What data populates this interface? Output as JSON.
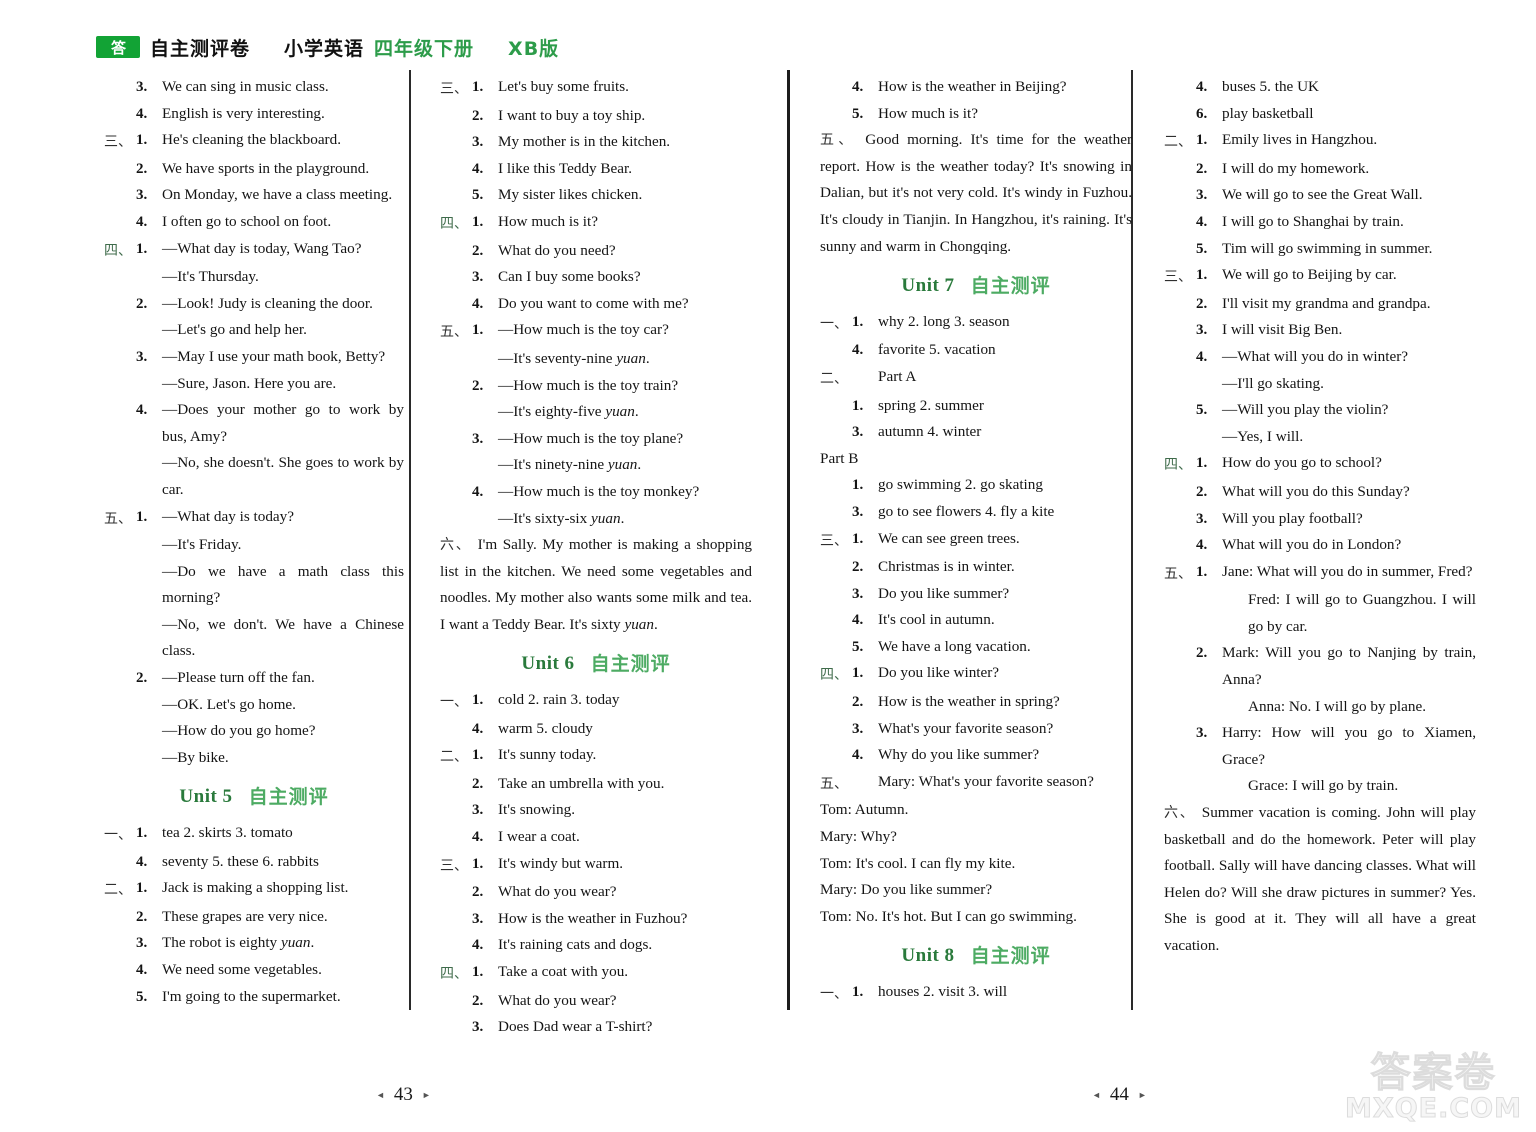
{
  "masthead": {
    "logo_text": "答",
    "title_cn": "自主测评卷",
    "subject": "小学英语",
    "grade": "四年级下册",
    "edition": "XB版",
    "brand_color": "#12a335"
  },
  "columns": {
    "col1": [
      {
        "kind": "item",
        "sec": "",
        "num": "3.",
        "text": "We can sing in music class."
      },
      {
        "kind": "item",
        "sec": "",
        "num": "4.",
        "text": "English is very interesting."
      },
      {
        "kind": "item",
        "sec": "三、",
        "num": "1.",
        "text": "He's cleaning the blackboard."
      },
      {
        "kind": "item",
        "sec": "",
        "num": "2.",
        "text": "We have sports in the playground."
      },
      {
        "kind": "item",
        "sec": "",
        "num": "3.",
        "text": "On Monday, we have a class meeting.",
        "justify": true
      },
      {
        "kind": "item",
        "sec": "",
        "num": "4.",
        "text": "I often go to school on foot."
      },
      {
        "kind": "item",
        "sec": "四、",
        "num": "1.",
        "text": "—What day is today, Wang Tao?",
        "box": true
      },
      {
        "kind": "hang",
        "text": "—It's Thursday."
      },
      {
        "kind": "item",
        "sec": "",
        "num": "2.",
        "text": "—Look! Judy is cleaning the door."
      },
      {
        "kind": "hang",
        "text": "—Let's go and help her."
      },
      {
        "kind": "item",
        "sec": "",
        "num": "3.",
        "text": "—May I use your math book, Betty?",
        "justify": true
      },
      {
        "kind": "hang",
        "text": "—Sure, Jason. Here you are."
      },
      {
        "kind": "item",
        "sec": "",
        "num": "4.",
        "text": "—Does your mother go to work by bus, Amy?",
        "justify": true
      },
      {
        "kind": "hang",
        "text": "—No, she doesn't. She goes to work by car.",
        "justify": true
      },
      {
        "kind": "item",
        "sec": "五、",
        "num": "1.",
        "text": "—What day is today?"
      },
      {
        "kind": "hang",
        "text": "—It's Friday."
      },
      {
        "kind": "hang",
        "text": "—Do we have a math class this morning?",
        "justify": true
      },
      {
        "kind": "hang",
        "text": "—No, we don't. We have a Chinese class.",
        "justify": true
      },
      {
        "kind": "item",
        "sec": "",
        "num": "2.",
        "text": "—Please turn off the fan."
      },
      {
        "kind": "hang",
        "text": "—OK. Let's go home."
      },
      {
        "kind": "hang",
        "text": "—How do you go home?"
      },
      {
        "kind": "hang",
        "text": "—By bike."
      },
      {
        "kind": "unit",
        "en": "Unit 5",
        "cn": "自主测评"
      },
      {
        "kind": "item",
        "sec": "一、",
        "num": "1.",
        "text": "tea   2. skirts   3. tomato"
      },
      {
        "kind": "item",
        "sec": "",
        "num": "4.",
        "text": "seventy   5. these   6. rabbits"
      },
      {
        "kind": "item",
        "sec": "二、",
        "num": "1.",
        "text": "Jack is making a shopping list."
      },
      {
        "kind": "item",
        "sec": "",
        "num": "2.",
        "text": "These grapes are very nice."
      },
      {
        "kind": "item",
        "sec": "",
        "num": "3.",
        "text": "The robot is eighty ",
        "italic": "yuan",
        "tail": "."
      },
      {
        "kind": "item",
        "sec": "",
        "num": "4.",
        "text": "We need some vegetables."
      },
      {
        "kind": "item",
        "sec": "",
        "num": "5.",
        "text": "I'm going to the supermarket."
      }
    ],
    "col2": [
      {
        "kind": "item",
        "sec": "三、",
        "num": "1.",
        "text": "Let's buy some fruits."
      },
      {
        "kind": "item",
        "sec": "",
        "num": "2.",
        "text": "I want to buy a toy ship."
      },
      {
        "kind": "item",
        "sec": "",
        "num": "3.",
        "text": "My mother is in the kitchen."
      },
      {
        "kind": "item",
        "sec": "",
        "num": "4.",
        "text": "I like this Teddy Bear."
      },
      {
        "kind": "item",
        "sec": "",
        "num": "5.",
        "text": "My sister likes chicken."
      },
      {
        "kind": "item",
        "sec": "四、",
        "num": "1.",
        "text": "How much is it?",
        "box": true
      },
      {
        "kind": "item",
        "sec": "",
        "num": "2.",
        "text": "What do you need?"
      },
      {
        "kind": "item",
        "sec": "",
        "num": "3.",
        "text": "Can I buy some books?"
      },
      {
        "kind": "item",
        "sec": "",
        "num": "4.",
        "text": "Do you want to come with me?"
      },
      {
        "kind": "item",
        "sec": "五、",
        "num": "1.",
        "text": "—How much is the toy car?"
      },
      {
        "kind": "hang",
        "text": "—It's seventy-nine ",
        "italic": "yuan",
        "tail": "."
      },
      {
        "kind": "item",
        "sec": "",
        "num": "2.",
        "text": "—How much is the toy train?"
      },
      {
        "kind": "hang",
        "text": "—It's eighty-five ",
        "italic": "yuan",
        "tail": "."
      },
      {
        "kind": "item",
        "sec": "",
        "num": "3.",
        "text": "—How much is the toy plane?"
      },
      {
        "kind": "hang",
        "text": "—It's ninety-nine ",
        "italic": "yuan",
        "tail": "."
      },
      {
        "kind": "item",
        "sec": "",
        "num": "4.",
        "text": "—How much is the toy monkey?"
      },
      {
        "kind": "hang",
        "text": "—It's sixty-six ",
        "italic": "yuan",
        "tail": "."
      },
      {
        "kind": "para",
        "lead": "六、",
        "text": "I'm Sally. My mother is making a shopping list in the kitchen. We need some vegetables and noodles. My mother also wants some milk and tea. I want a Teddy Bear. It's sixty ",
        "italic": "yuan",
        "tail": "."
      },
      {
        "kind": "unit",
        "en": "Unit 6",
        "cn": "自主测评"
      },
      {
        "kind": "item",
        "sec": "一、",
        "num": "1.",
        "text": "cold   2. rain   3. today"
      },
      {
        "kind": "item",
        "sec": "",
        "num": "4.",
        "text": "warm   5. cloudy"
      },
      {
        "kind": "item",
        "sec": "二、",
        "num": "1.",
        "text": "It's sunny today."
      },
      {
        "kind": "item",
        "sec": "",
        "num": "2.",
        "text": "Take an umbrella with you."
      },
      {
        "kind": "item",
        "sec": "",
        "num": "3.",
        "text": "It's snowing."
      },
      {
        "kind": "item",
        "sec": "",
        "num": "4.",
        "text": "I wear a coat."
      },
      {
        "kind": "item",
        "sec": "三、",
        "num": "1.",
        "text": "It's windy but warm."
      },
      {
        "kind": "item",
        "sec": "",
        "num": "2.",
        "text": "What do you wear?"
      },
      {
        "kind": "item",
        "sec": "",
        "num": "3.",
        "text": "How is the weather in Fuzhou?",
        "justify": true
      },
      {
        "kind": "item",
        "sec": "",
        "num": "4.",
        "text": "It's raining cats and dogs."
      },
      {
        "kind": "item",
        "sec": "四、",
        "num": "1.",
        "text": "Take a coat with you.",
        "box": true
      },
      {
        "kind": "item",
        "sec": "",
        "num": "2.",
        "text": "What do you wear?"
      },
      {
        "kind": "item",
        "sec": "",
        "num": "3.",
        "text": "Does Dad wear a T-shirt?"
      }
    ],
    "col3": [
      {
        "kind": "item",
        "sec": "",
        "num": "4.",
        "text": "How is the weather in Beijing?",
        "justify": true
      },
      {
        "kind": "item",
        "sec": "",
        "num": "5.",
        "text": "How much is it?"
      },
      {
        "kind": "para",
        "lead": "五、",
        "text": "Good morning. It's time for the weather report. How is the weather today? It's snowing in Dalian, but it's not very cold. It's windy in Fuzhou. It's cloudy in Tianjin. In Hangzhou, it's raining. It's sunny and warm in Chongqing."
      },
      {
        "kind": "unit",
        "en": "Unit 7",
        "cn": "自主测评"
      },
      {
        "kind": "item",
        "sec": "一、",
        "num": "1.",
        "text": "why   2. long   3. season"
      },
      {
        "kind": "item",
        "sec": "",
        "num": "4.",
        "text": "favorite   5. vacation"
      },
      {
        "kind": "item",
        "sec": "二、",
        "num": "",
        "text": "Part A"
      },
      {
        "kind": "item",
        "sec": "",
        "num": "1.",
        "text": "spring   2. summer"
      },
      {
        "kind": "item",
        "sec": "",
        "num": "3.",
        "text": "autumn   4. winter"
      },
      {
        "kind": "plain",
        "text": "Part B"
      },
      {
        "kind": "item",
        "sec": "",
        "num": "1.",
        "text": "go swimming   2. go skating"
      },
      {
        "kind": "item",
        "sec": "",
        "num": "3.",
        "text": "go to see flowers   4. fly a kite"
      },
      {
        "kind": "item",
        "sec": "三、",
        "num": "1.",
        "text": "We can see green trees."
      },
      {
        "kind": "item",
        "sec": "",
        "num": "2.",
        "text": "Christmas is in winter."
      },
      {
        "kind": "item",
        "sec": "",
        "num": "3.",
        "text": "Do you like summer?"
      },
      {
        "kind": "item",
        "sec": "",
        "num": "4.",
        "text": "It's cool in autumn."
      },
      {
        "kind": "item",
        "sec": "",
        "num": "5.",
        "text": "We have a long vacation."
      },
      {
        "kind": "item",
        "sec": "四、",
        "num": "1.",
        "text": "Do you like winter?",
        "box": true
      },
      {
        "kind": "item",
        "sec": "",
        "num": "2.",
        "text": "How is the weather in spring?"
      },
      {
        "kind": "item",
        "sec": "",
        "num": "3.",
        "text": "What's your favorite season?"
      },
      {
        "kind": "item",
        "sec": "",
        "num": "4.",
        "text": "Why do you like summer?"
      },
      {
        "kind": "item",
        "sec": "五、",
        "num": "",
        "text": "Mary: What's your favorite season?"
      },
      {
        "kind": "plain",
        "text": "Tom: Autumn."
      },
      {
        "kind": "plain",
        "text": "Mary: Why?"
      },
      {
        "kind": "plain",
        "text": " Tom: It's cool. I can fly my kite."
      },
      {
        "kind": "plain",
        "text": "Mary: Do you like summer?"
      },
      {
        "kind": "plain",
        "text": " Tom: No. It's hot. But I can go swimming."
      },
      {
        "kind": "unit",
        "en": "Unit 8",
        "cn": "自主测评"
      },
      {
        "kind": "item",
        "sec": "一、",
        "num": "1.",
        "text": "houses   2. visit   3. will"
      }
    ],
    "col4": [
      {
        "kind": "item",
        "sec": "",
        "num": "4.",
        "text": "buses   5. the UK"
      },
      {
        "kind": "item",
        "sec": "",
        "num": "6.",
        "text": "play basketball"
      },
      {
        "kind": "item",
        "sec": "二、",
        "num": "1.",
        "text": "Emily lives in Hangzhou."
      },
      {
        "kind": "item",
        "sec": "",
        "num": "2.",
        "text": "I will do my homework."
      },
      {
        "kind": "item",
        "sec": "",
        "num": "3.",
        "text": "We will go to see the Great Wall."
      },
      {
        "kind": "item",
        "sec": "",
        "num": "4.",
        "text": "I will go to Shanghai by train."
      },
      {
        "kind": "item",
        "sec": "",
        "num": "5.",
        "text": "Tim will go swimming in summer."
      },
      {
        "kind": "item",
        "sec": "三、",
        "num": "1.",
        "text": "We will go to Beijing by car."
      },
      {
        "kind": "item",
        "sec": "",
        "num": "2.",
        "text": "I'll visit my grandma and grandpa."
      },
      {
        "kind": "item",
        "sec": "",
        "num": "3.",
        "text": "I will visit Big Ben."
      },
      {
        "kind": "item",
        "sec": "",
        "num": "4.",
        "text": "—What will you do in winter?",
        "justify": true
      },
      {
        "kind": "hang",
        "text": "—I'll go skating."
      },
      {
        "kind": "item",
        "sec": "",
        "num": "5.",
        "text": "—Will you play the violin?"
      },
      {
        "kind": "hang",
        "text": "—Yes, I will."
      },
      {
        "kind": "item",
        "sec": "四、",
        "num": "1.",
        "text": "How do you go to school?",
        "box": true
      },
      {
        "kind": "item",
        "sec": "",
        "num": "2.",
        "text": "What will you do this Sunday?",
        "justify": true
      },
      {
        "kind": "item",
        "sec": "",
        "num": "3.",
        "text": "Will you play football?"
      },
      {
        "kind": "item",
        "sec": "",
        "num": "4.",
        "text": "What will you do in London?"
      },
      {
        "kind": "item",
        "sec": "五、",
        "num": "1.",
        "text": "Jane: What will you do in summer, Fred?",
        "justify": true
      },
      {
        "kind": "hang2",
        "text": "Fred: I will go to Guangzhou. I will go by car.",
        "justify": true
      },
      {
        "kind": "item",
        "sec": "",
        "num": "2.",
        "text": "Mark: Will you go to Nanjing by train, Anna?",
        "justify": true
      },
      {
        "kind": "hang2",
        "text": "Anna: No. I will go by plane."
      },
      {
        "kind": "item",
        "sec": "",
        "num": "3.",
        "text": "Harry: How will you go to Xiamen, Grace?",
        "justify": true
      },
      {
        "kind": "hang2",
        "text": "Grace: I will go by train."
      },
      {
        "kind": "para",
        "lead": "六、",
        "text": "Summer vacation is coming. John will play basketball and do the homework. Peter will play football. Sally will have dancing classes. What will Helen do? Will she draw pictures in summer? Yes. She is good at it. They will all have a great vacation."
      }
    ]
  },
  "footer": {
    "page_left": "43",
    "page_right": "44",
    "prev_glyph": "◄",
    "next_glyph": "►"
  },
  "watermark": {
    "cn": "答案卷",
    "en": "MXQE.COM"
  }
}
